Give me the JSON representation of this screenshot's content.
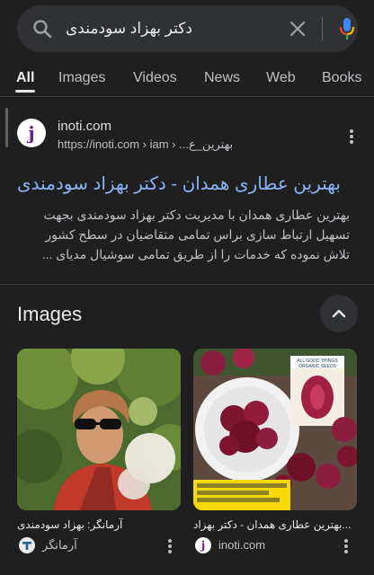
{
  "search": {
    "query": "دکتر بهزاد سودمندی",
    "icons": {
      "search": "search-icon",
      "clear": "close-icon",
      "voice": "mic-icon"
    }
  },
  "tabs": [
    {
      "label": "All",
      "active": true
    },
    {
      "label": "Images",
      "active": false
    },
    {
      "label": "Videos",
      "active": false
    },
    {
      "label": "News",
      "active": false
    },
    {
      "label": "Web",
      "active": false
    },
    {
      "label": "Books",
      "active": false
    }
  ],
  "result": {
    "site_name": "inoti.com",
    "url": "https://inoti.com › iam › ...بهترین_ع",
    "title": "بهترین عطاری همدان - دکتر بهزاد سودمندی",
    "snippet": "بهترین عطاری همدان با مدیریت دکتر بهزاد سودمندی بجهت تسهیل ارتباط سازی براس تمامی متقاضیان در سطح کشور تلاش نموده که خدمات را از طریق تمامی سوشیال مدیای ..."
  },
  "images": {
    "heading": "Images",
    "cards": [
      {
        "caption": "آرمانگر: بهزاد سودمندی",
        "source": "آرمانگر",
        "icon": "armangar-logo-icon"
      },
      {
        "caption": "...بهترین عطاری همدان - دکتر بهزاد",
        "source": "inoti.com",
        "icon": "inoti-logo-icon"
      }
    ],
    "product_box": {
      "line1": "ALL GOOD THINGS",
      "line2": "ORGANIC SEEDS"
    }
  },
  "colors": {
    "background": "#1f1f1f",
    "search_bg": "#303134",
    "link": "#8ab4f8",
    "text_primary": "#e8eaed",
    "text_secondary": "#bdc1c6",
    "divider": "#3c4043"
  }
}
